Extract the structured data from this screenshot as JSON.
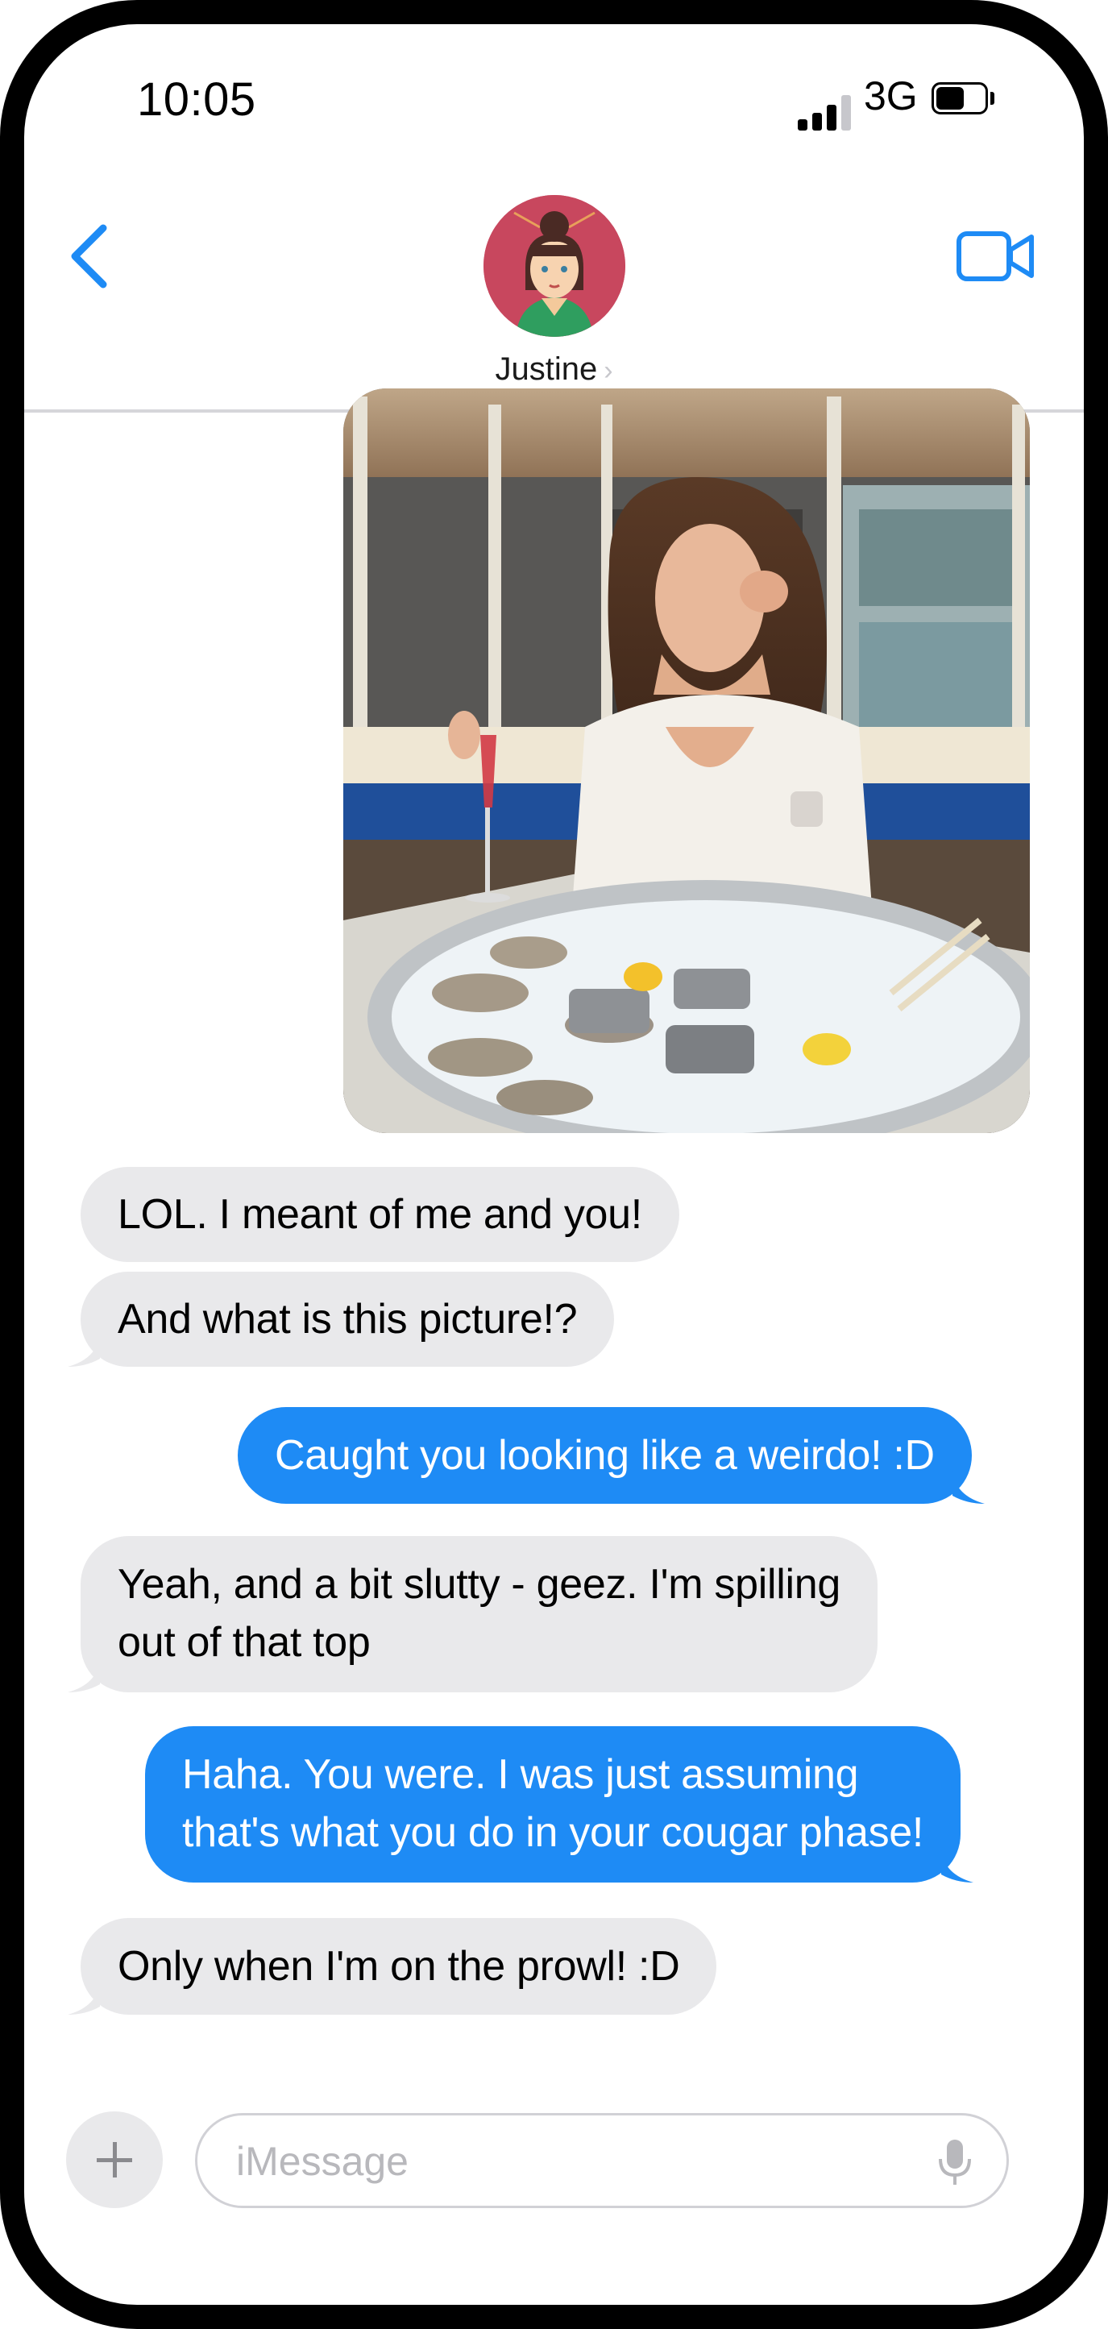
{
  "status_bar": {
    "time": "10:05",
    "network": "3G",
    "icons": [
      "signal-icon",
      "battery-icon"
    ]
  },
  "header": {
    "contact_name": "Justine",
    "chevron": "›",
    "icons": [
      "back-chevron-icon",
      "video-call-icon"
    ]
  },
  "messages": [
    {
      "type": "image",
      "direction": "outgoing",
      "icon": "photo-attachment"
    },
    {
      "direction": "incoming",
      "lines": [
        "LOL.  I meant of me and you!"
      ]
    },
    {
      "direction": "incoming",
      "lines": [
        "And what is this picture!?"
      ]
    },
    {
      "direction": "outgoing",
      "lines": [
        "Caught you looking like a weirdo! :D"
      ]
    },
    {
      "direction": "incoming",
      "lines": [
        "Yeah, and a bit slutty - geez.  I'm spilling",
        "out of that top"
      ]
    },
    {
      "direction": "outgoing",
      "lines": [
        "Haha.  You were.  I was just assuming",
        "that's what you do in your cougar phase!"
      ]
    },
    {
      "direction": "incoming",
      "lines": [
        "Only when I'm on the prowl! :D"
      ]
    }
  ],
  "compose": {
    "placeholder": "iMessage",
    "value": "",
    "icons": [
      "plus-icon",
      "microphone-icon"
    ]
  },
  "colors": {
    "accent": "#1e8bf5",
    "incoming_bubble": "#e9e9eb",
    "outgoing_bubble": "#1e8bf5",
    "frame": "#000000"
  }
}
